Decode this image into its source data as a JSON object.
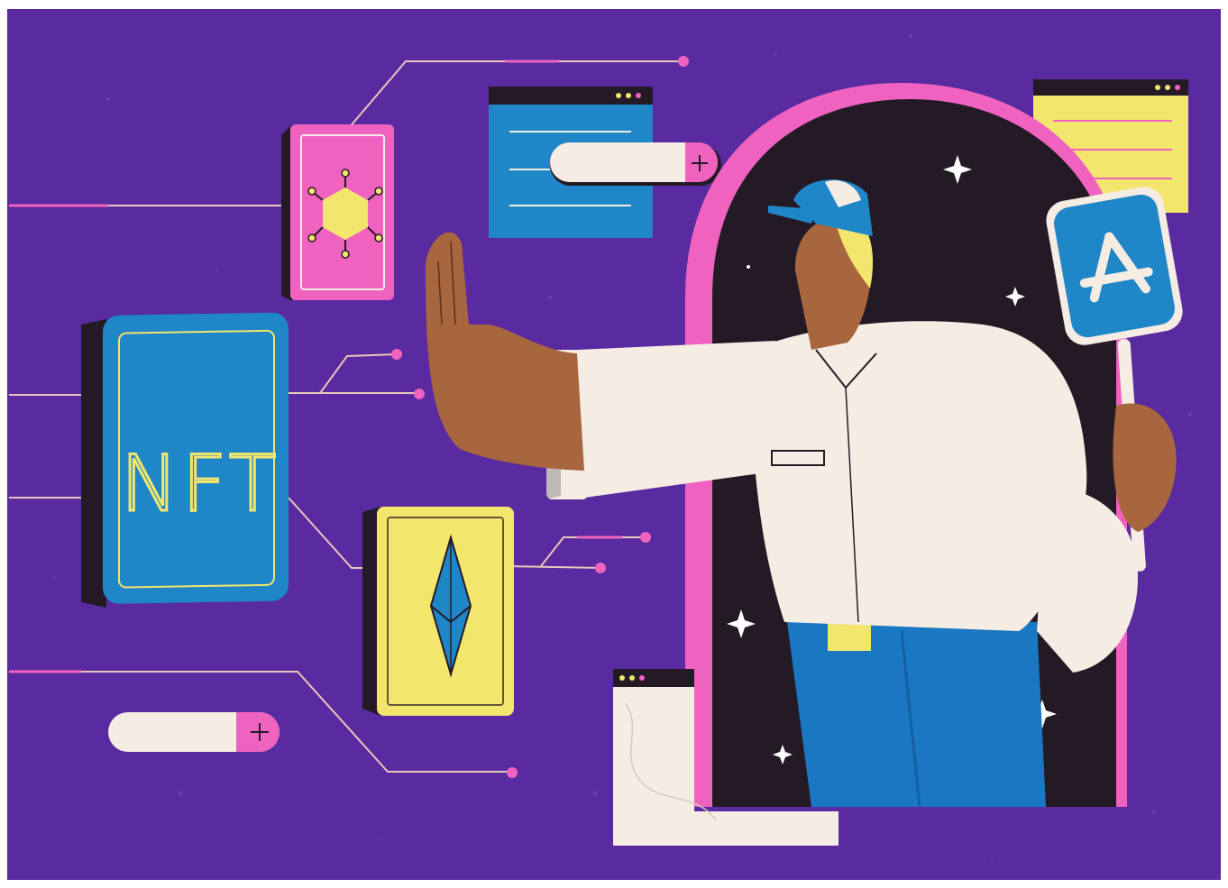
{
  "illustration": {
    "nft_tile": {
      "label": "NFT"
    },
    "colors": {
      "background": "#5a2aa0",
      "frame": "#ffffff",
      "ink": "#241a26",
      "pink": "#f062c0",
      "blue": "#1f86c8",
      "yellow": "#f3e66c",
      "cream": "#f5ece3",
      "skin": "#a8663f",
      "denim": "#1a78c2",
      "line": "#e6c9b8"
    },
    "icons": [
      "nft-tile",
      "hexagon-network-icon",
      "ethereum-icon",
      "app-store-icon",
      "browser-window-icon",
      "plus-icon",
      "sparkle-icon",
      "person-figure"
    ]
  }
}
